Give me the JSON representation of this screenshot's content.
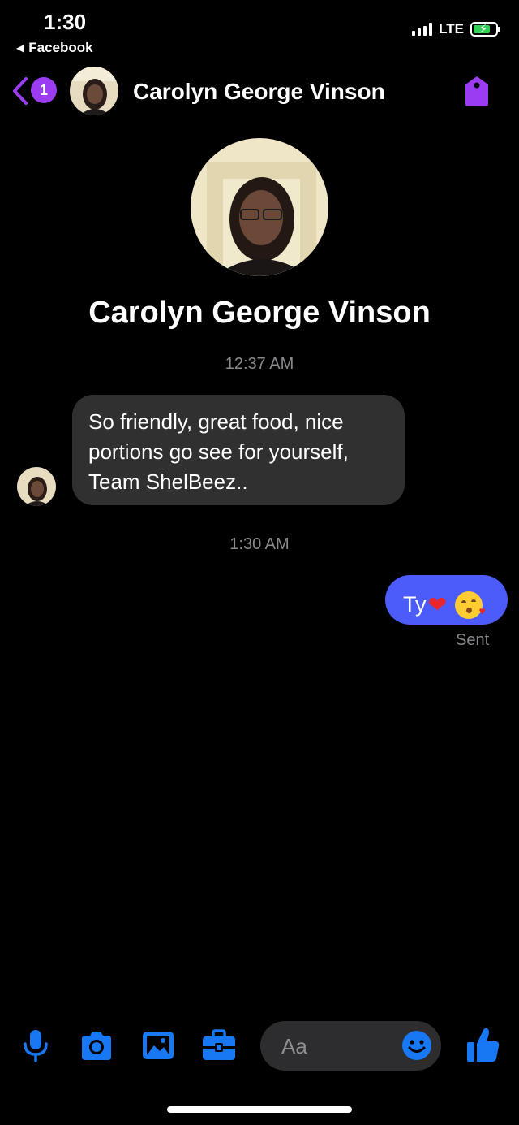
{
  "status_bar": {
    "time": "1:30",
    "back_app": "Facebook",
    "network": "LTE"
  },
  "header": {
    "back_count": "1",
    "contact_name": "Carolyn George Vinson"
  },
  "profile": {
    "name": "Carolyn George Vinson"
  },
  "conversation": [
    {
      "type": "timestamp",
      "text": "12:37 AM"
    },
    {
      "type": "incoming",
      "text": "So friendly, great food, nice portions go see for yourself, Team ShelBeez.."
    },
    {
      "type": "timestamp",
      "text": "1:30 AM"
    },
    {
      "type": "outgoing",
      "text": "Ty",
      "emoji": [
        "red-heart",
        "face-blowing-kiss"
      ],
      "status": "Sent"
    }
  ],
  "composer": {
    "placeholder": "Aa"
  },
  "colors": {
    "accent_purple": "#9b3cf2",
    "outgoing_bubble": "#4c5cfb",
    "incoming_bubble": "#303030",
    "toolbar_blue": "#1877f2"
  },
  "icons": [
    "back-chevron-icon",
    "tag-icon",
    "microphone-icon",
    "camera-icon",
    "photo-icon",
    "briefcase-icon",
    "smiley-icon",
    "thumbs-up-icon"
  ]
}
